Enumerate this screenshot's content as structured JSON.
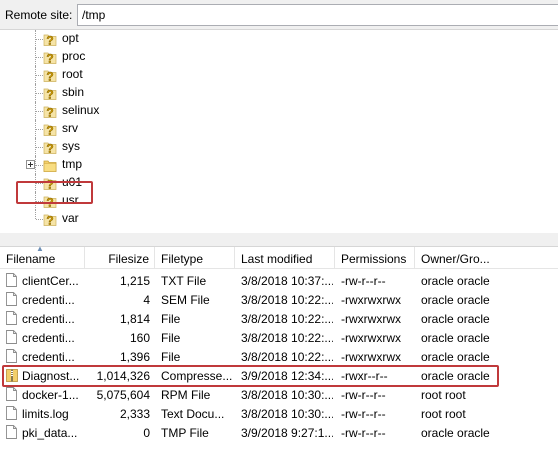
{
  "remote_site": {
    "label": "Remote site:",
    "path": "/tmp"
  },
  "tree": {
    "items": [
      {
        "label": "opt",
        "icon": "unknown-folder-icon"
      },
      {
        "label": "proc",
        "icon": "unknown-folder-icon"
      },
      {
        "label": "root",
        "icon": "unknown-folder-icon"
      },
      {
        "label": "sbin",
        "icon": "unknown-folder-icon"
      },
      {
        "label": "selinux",
        "icon": "unknown-folder-icon"
      },
      {
        "label": "srv",
        "icon": "unknown-folder-icon"
      },
      {
        "label": "sys",
        "icon": "unknown-folder-icon"
      },
      {
        "label": "tmp",
        "icon": "folder-icon",
        "selected": true
      },
      {
        "label": "u01",
        "icon": "unknown-folder-icon"
      },
      {
        "label": "usr",
        "icon": "unknown-folder-icon"
      },
      {
        "label": "var",
        "icon": "unknown-folder-icon"
      }
    ]
  },
  "columns": [
    "Filename",
    "Filesize",
    "Filetype",
    "Last modified",
    "Permissions",
    "Owner/Gro..."
  ],
  "files": [
    {
      "name": "clientCer...",
      "size": "1,215",
      "type": "TXT File",
      "modified": "3/8/2018 10:37:...",
      "perms": "-rw-r--r--",
      "owner": "oracle oracle",
      "icon": "file-icon"
    },
    {
      "name": "credenti...",
      "size": "4",
      "type": "SEM File",
      "modified": "3/8/2018 10:22:...",
      "perms": "-rwxrwxrwx",
      "owner": "oracle oracle",
      "icon": "file-icon"
    },
    {
      "name": "credenti...",
      "size": "1,814",
      "type": "File",
      "modified": "3/8/2018 10:22:...",
      "perms": "-rwxrwxrwx",
      "owner": "oracle oracle",
      "icon": "file-icon"
    },
    {
      "name": "credenti...",
      "size": "160",
      "type": "File",
      "modified": "3/8/2018 10:22:...",
      "perms": "-rwxrwxrwx",
      "owner": "oracle oracle",
      "icon": "file-icon"
    },
    {
      "name": "credenti...",
      "size": "1,396",
      "type": "File",
      "modified": "3/8/2018 10:22:...",
      "perms": "-rwxrwxrwx",
      "owner": "oracle oracle",
      "icon": "file-icon"
    },
    {
      "name": "Diagnost...",
      "size": "1,014,326",
      "type": "Compresse...",
      "modified": "3/9/2018 12:34:...",
      "perms": "-rwxr--r--",
      "owner": "oracle oracle",
      "icon": "zip-file-icon"
    },
    {
      "name": "docker-1...",
      "size": "5,075,604",
      "type": "RPM File",
      "modified": "3/8/2018 10:30:...",
      "perms": "-rw-r--r--",
      "owner": "root root",
      "icon": "file-icon"
    },
    {
      "name": "limits.log",
      "size": "2,333",
      "type": "Text Docu...",
      "modified": "3/8/2018 10:30:...",
      "perms": "-rw-r--r--",
      "owner": "root root",
      "icon": "file-icon"
    },
    {
      "name": "pki_data...",
      "size": "0",
      "type": "TMP File",
      "modified": "3/9/2018 9:27:1...",
      "perms": "-rw-r--r--",
      "owner": "oracle oracle",
      "icon": "file-icon"
    }
  ],
  "colors": {
    "highlight": "#c0393b",
    "folder": "#f2cf6b",
    "question": "#d8a200"
  }
}
